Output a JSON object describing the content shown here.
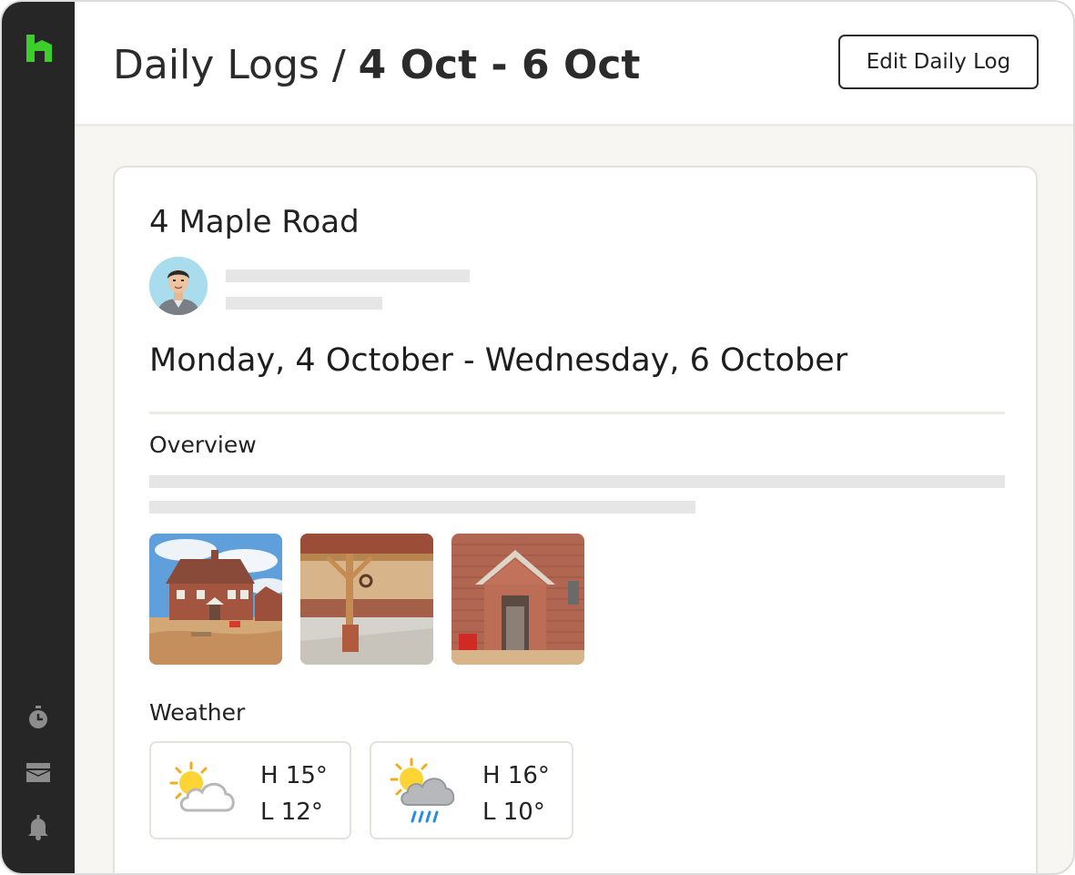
{
  "header": {
    "breadcrumb": "Daily Logs /",
    "date_range": "4 Oct - 6 Oct",
    "edit_label": "Edit Daily Log"
  },
  "log": {
    "project": "4 Maple Road",
    "date_range_full": "Monday, 4 October - Wednesday, 6 October",
    "overview_label": "Overview",
    "weather_label": "Weather",
    "photos": [
      {
        "icon": "house-exterior-photo"
      },
      {
        "icon": "timber-frame-garage-photo"
      },
      {
        "icon": "brick-porch-photo"
      }
    ],
    "weather": [
      {
        "icon": "partly-cloudy-icon",
        "high": "H 15°",
        "low": "L 12°"
      },
      {
        "icon": "sun-rain-cloud-icon",
        "high": "H 16°",
        "low": "L 10°"
      }
    ]
  },
  "sidebar": {
    "icons": [
      "logo-icon",
      "stopwatch-icon",
      "inbox-icon",
      "bell-icon"
    ]
  },
  "colors": {
    "brand_green": "#3ccf2c",
    "sidebar": "#262626",
    "skeleton": "#e6e6e6"
  }
}
